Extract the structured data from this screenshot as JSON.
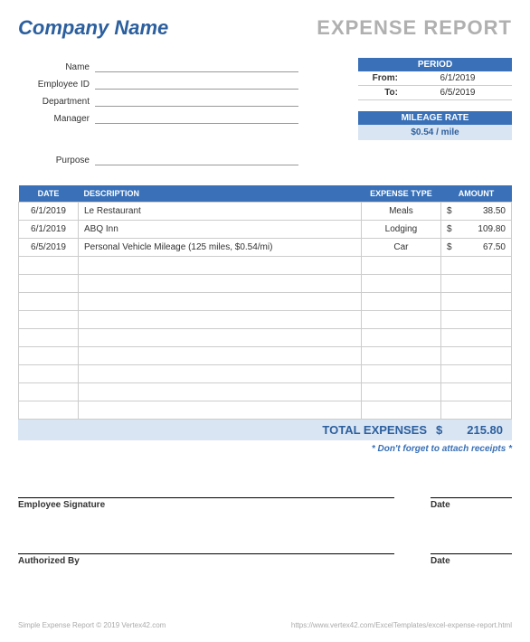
{
  "header": {
    "company": "Company Name",
    "title": "EXPENSE REPORT"
  },
  "fields": {
    "name_label": "Name",
    "employee_id_label": "Employee ID",
    "department_label": "Department",
    "manager_label": "Manager",
    "purpose_label": "Purpose"
  },
  "period": {
    "header": "PERIOD",
    "from_label": "From:",
    "from_value": "6/1/2019",
    "to_label": "To:",
    "to_value": "6/5/2019"
  },
  "mileage": {
    "header": "MILEAGE RATE",
    "value": "$0.54 / mile"
  },
  "table": {
    "headers": {
      "date": "DATE",
      "description": "DESCRIPTION",
      "expense_type": "EXPENSE TYPE",
      "amount": "AMOUNT"
    },
    "rows": [
      {
        "date": "6/1/2019",
        "description": "Le Restaurant",
        "type": "Meals",
        "currency": "$",
        "amount": "38.50"
      },
      {
        "date": "6/1/2019",
        "description": "ABQ Inn",
        "type": "Lodging",
        "currency": "$",
        "amount": "109.80"
      },
      {
        "date": "6/5/2019",
        "description": "Personal Vehicle Mileage (125 miles, $0.54/mi)",
        "type": "Car",
        "currency": "$",
        "amount": "67.50"
      }
    ],
    "empty_rows": 9
  },
  "total": {
    "label": "TOTAL EXPENSES",
    "currency": "$",
    "amount": "215.80"
  },
  "note": "* Don't forget to attach receipts *",
  "signatures": {
    "employee": "Employee Signature",
    "employee_date": "Date",
    "authorized": "Authorized By",
    "authorized_date": "Date"
  },
  "footer": {
    "left": "Simple Expense Report © 2019 Vertex42.com",
    "right": "https://www.vertex42.com/ExcelTemplates/excel-expense-report.html"
  }
}
